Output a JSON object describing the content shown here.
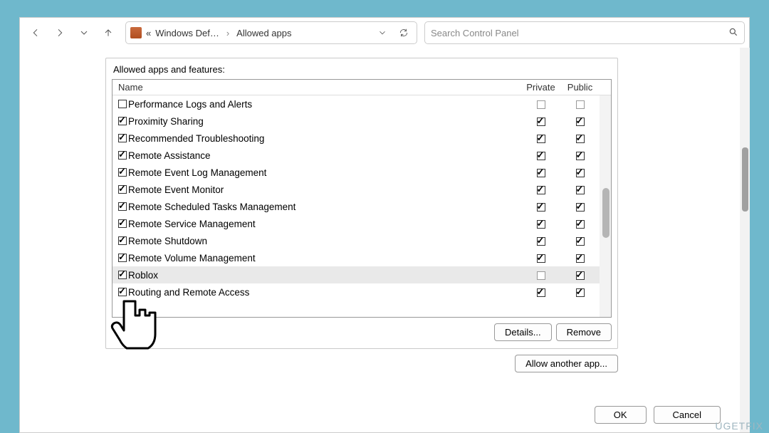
{
  "nav": {
    "crumb_prefix": "«",
    "crumb1": "Windows Def…",
    "crumb2": "Allowed apps"
  },
  "search": {
    "placeholder": "Search Control Panel"
  },
  "group": {
    "title": "Allowed apps and features:"
  },
  "headers": {
    "name": "Name",
    "private": "Private",
    "public": "Public"
  },
  "rows": [
    {
      "label": "Performance Logs and Alerts",
      "on": false,
      "priv": false,
      "pub": false,
      "sel": false
    },
    {
      "label": "Proximity Sharing",
      "on": true,
      "priv": true,
      "pub": true,
      "sel": false
    },
    {
      "label": "Recommended Troubleshooting",
      "on": true,
      "priv": true,
      "pub": true,
      "sel": false
    },
    {
      "label": "Remote Assistance",
      "on": true,
      "priv": true,
      "pub": true,
      "sel": false
    },
    {
      "label": "Remote Event Log Management",
      "on": true,
      "priv": true,
      "pub": true,
      "sel": false
    },
    {
      "label": "Remote Event Monitor",
      "on": true,
      "priv": true,
      "pub": true,
      "sel": false
    },
    {
      "label": "Remote Scheduled Tasks Management",
      "on": true,
      "priv": true,
      "pub": true,
      "sel": false
    },
    {
      "label": "Remote Service Management",
      "on": true,
      "priv": true,
      "pub": true,
      "sel": false
    },
    {
      "label": "Remote Shutdown",
      "on": true,
      "priv": true,
      "pub": true,
      "sel": false
    },
    {
      "label": "Remote Volume Management",
      "on": true,
      "priv": true,
      "pub": true,
      "sel": false
    },
    {
      "label": "Roblox",
      "on": true,
      "priv": false,
      "pub": true,
      "sel": true
    },
    {
      "label": "Routing and Remote Access",
      "on": true,
      "priv": true,
      "pub": true,
      "sel": false
    }
  ],
  "buttons": {
    "details": "Details...",
    "remove": "Remove",
    "allow": "Allow another app...",
    "ok": "OK",
    "cancel": "Cancel"
  },
  "watermark": "UGETFIX"
}
